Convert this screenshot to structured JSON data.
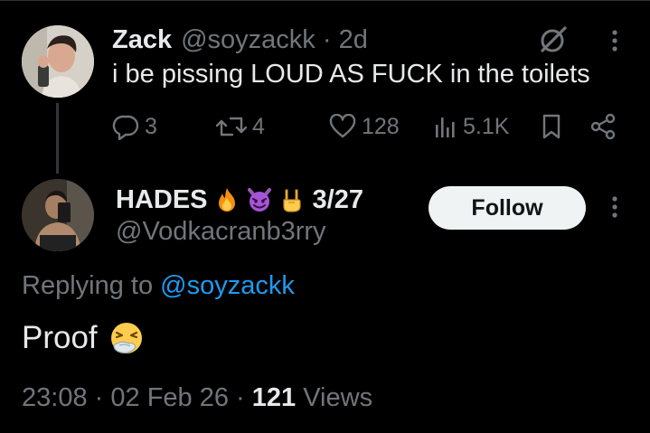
{
  "parent_tweet": {
    "display_name": "Zack",
    "handle": "@soyzackk",
    "separator": "·",
    "age": "2d",
    "text": "i be pissing LOUD AS FUCK in the toilets",
    "actions": {
      "replies": "3",
      "reposts": "4",
      "likes": "128",
      "views": "5.1K"
    }
  },
  "reply": {
    "display_name": "HADES",
    "name_emojis": [
      "fire-emoji",
      "smiling-devil-emoji",
      "sign-of-horns-emoji"
    ],
    "name_suffix": "3/27",
    "handle": "@Vodkacranb3rry",
    "follow_label": "Follow",
    "replying_prefix": "Replying to",
    "replying_mention": "@soyzackk",
    "text": "Proof",
    "text_emoji": "sneezing-face-emoji",
    "time": "23:08",
    "date": "02 Feb 26",
    "views_count": "121",
    "views_label": "Views"
  },
  "colors": {
    "background": "#000000",
    "primary_text": "#e7e9ea",
    "secondary_text": "#71767b",
    "link": "#1d9bf0",
    "follow_button_bg": "#eff3f4"
  }
}
